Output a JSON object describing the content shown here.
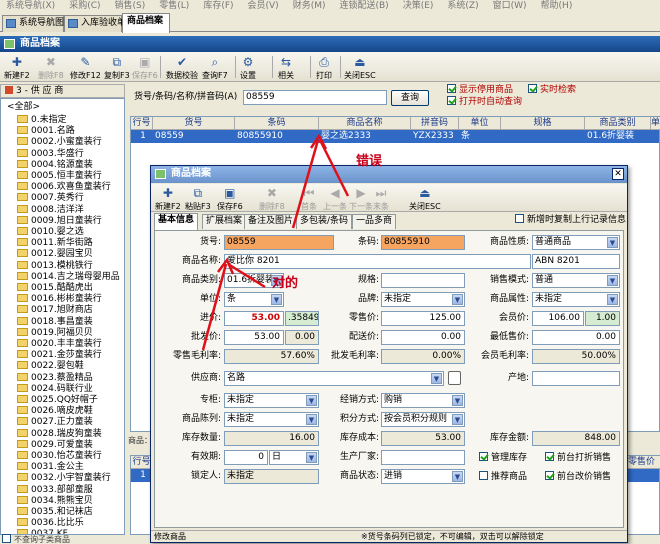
{
  "menu": [
    "系统导航(X)",
    "采购(C)",
    "销售(S)",
    "零售(L)",
    "库存(F)",
    "会员(V)",
    "财务(M)",
    "连锁配送(B)",
    "决策(E)",
    "系统(Z)",
    "窗口(W)",
    "帮助(H)"
  ],
  "tabs": [
    "系统导航图",
    "入库验收单",
    "商品档案"
  ],
  "main_window": {
    "title": "商品档案"
  },
  "main_toolbar": [
    {
      "label": "新建F2",
      "icon": "✚",
      "enabled": true
    },
    {
      "label": "删除F8",
      "icon": "✖",
      "enabled": false
    },
    {
      "label": "修改F12",
      "icon": "✎",
      "enabled": true
    },
    {
      "label": "复制F3",
      "icon": "⧉",
      "enabled": true
    },
    {
      "label": "保存F6",
      "icon": "▣",
      "enabled": false
    },
    {
      "label": "数据校验",
      "icon": "✔",
      "enabled": true
    },
    {
      "label": "查询F7",
      "icon": "⌕",
      "enabled": true
    },
    {
      "label": "设置",
      "icon": "⚙",
      "enabled": true
    },
    {
      "label": "相关",
      "icon": "⇆",
      "enabled": true
    },
    {
      "label": "打印",
      "icon": "⎙",
      "enabled": true
    },
    {
      "label": "关闭ESC",
      "icon": "⏏",
      "enabled": true
    }
  ],
  "tree": {
    "header": "3 - 供 应 商",
    "root": "<全部>",
    "items": [
      "0.未指定",
      "0001.名路",
      "0002.小蜜童装行",
      "0003.华盛行",
      "0004.铭源童装",
      "0005.恒丰童装行",
      "0006.欢喜鱼童装行",
      "0007.英秀行",
      "0008.洁洋洋",
      "0009.旭日童装行",
      "0010.婴之选",
      "0011.新华街路",
      "0012.婴园宝贝",
      "0013.模桃铁行",
      "0014.吉之瑞母婴用品",
      "0015.酷酷虎出",
      "0016.彬彬童装行",
      "0017.旭财商店",
      "0018.事昌童装",
      "0019.阿福贝贝",
      "0020.丰丰童装行",
      "0021.金莎童装行",
      "0022.婴包鞋",
      "0023.蔡盈精品",
      "0024.码联行业",
      "0025.QQ好帽子",
      "0026.嘀皮虎鞋",
      "0027.正力童装",
      "0028.瑞皮狗童装",
      "0029.可爱童装",
      "0030.怡芯童装行",
      "0031.金公主",
      "0032.小宇智童装行",
      "0033.部部童服",
      "0034.熊熊宝贝",
      "0035.和记袜店",
      "0036.比比乐",
      "0037.KF"
    ],
    "footer_label": "不查询子类商品"
  },
  "search": {
    "label": "货号/条码/名称/拼音码(A)",
    "value": "08559",
    "button": "查询"
  },
  "options": [
    {
      "label": "显示停用商品",
      "checked": true
    },
    {
      "label": "打开时自动查询",
      "checked": true
    },
    {
      "label": "实时检索",
      "checked": true
    }
  ],
  "grid": {
    "headers": [
      "行号",
      "货号",
      "条码",
      "商品名称",
      "拼音码",
      "单位",
      "规格",
      "商品类别",
      "单"
    ],
    "row": [
      "1",
      "08559",
      "80855910",
      "婴之选2333",
      "YZX2333",
      "条",
      "",
      "01.6折婴装",
      ""
    ]
  },
  "lower_grid": {
    "headers": [
      "行号",
      "商",
      "零售价"
    ],
    "row": [
      "1",
      "0"
    ]
  },
  "status": "商品：1 条",
  "annotations": {
    "wrong": "错误",
    "right": "对的"
  },
  "dialog": {
    "title": "商品档案",
    "toolbar": [
      {
        "label": "新建F2",
        "icon": "✚",
        "enabled": true
      },
      {
        "label": "粘贴F3",
        "icon": "⧉",
        "enabled": true
      },
      {
        "label": "保存F6",
        "icon": "▣",
        "enabled": true
      },
      {
        "label": "删除F8",
        "icon": "✖",
        "enabled": false
      },
      {
        "label": "首条",
        "icon": "⏮",
        "enabled": false
      },
      {
        "label": "上一条",
        "icon": "◀",
        "enabled": false
      },
      {
        "label": "下一条",
        "icon": "▶",
        "enabled": false
      },
      {
        "label": "末条",
        "icon": "⏭",
        "enabled": false
      },
      {
        "label": "关闭ESC",
        "icon": "⏏",
        "enabled": true
      }
    ],
    "tabs": [
      "基本信息",
      "扩展档案",
      "备注及图片",
      "多包装/条码",
      "一品多商"
    ],
    "copy_new_label": "新增时复制上行记录信息",
    "fields": {
      "goods_no": {
        "label": "货号:",
        "value": "08559"
      },
      "barcode": {
        "label": "条码:",
        "value": "80855910"
      },
      "goods_nature": {
        "label": "商品性质:",
        "value": "普通商品"
      },
      "goods_name": {
        "label": "商品名称:",
        "value": "爱比你 8201"
      },
      "goods_name_py": {
        "value": "ABN 8201"
      },
      "category": {
        "label": "商品类别:",
        "value": "01.6折婴装"
      },
      "spec": {
        "label": "规格:",
        "value": ""
      },
      "sale_mode": {
        "label": "销售模式:",
        "value": "普通"
      },
      "unit": {
        "label": "单位:",
        "value": "条"
      },
      "brand": {
        "label": "品牌:",
        "value": "未指定"
      },
      "attr": {
        "label": "商品属性:",
        "value": "未指定"
      },
      "purchase_price": {
        "label": "进价:",
        "value": "53.00",
        "ratio": ".358491"
      },
      "retail_price": {
        "label": "零售价:",
        "value": "125.00"
      },
      "member_price": {
        "label": "会员价:",
        "value": "106.00",
        "ratio": "1.00"
      },
      "wholesale_price": {
        "label": "批发价:",
        "value": "53.00",
        "ratio": "0.00"
      },
      "dist_price": {
        "label": "配送价:",
        "value": "0.00"
      },
      "min_price": {
        "label": "最低售价:",
        "value": "0.00"
      },
      "retail_margin": {
        "label": "零售毛利率:",
        "value": "57.60%"
      },
      "wholesale_margin": {
        "label": "批发毛利率:",
        "value": "0.00%"
      },
      "member_margin": {
        "label": "会员毛利率:",
        "value": "50.00%"
      },
      "supplier": {
        "label": "供应商:",
        "value": "名路"
      },
      "origin": {
        "label": "产地:",
        "value": ""
      },
      "counter": {
        "label": "专柜:",
        "value": "未指定"
      },
      "biz_mode": {
        "label": "经销方式:",
        "value": "购销"
      },
      "display": {
        "label": "商品陈列:",
        "value": "未指定"
      },
      "points": {
        "label": "积分方式:",
        "value": "按会员积分规则"
      },
      "stock_qty": {
        "label": "库存数量:",
        "value": "16.00"
      },
      "stock_cost": {
        "label": "库存成本:",
        "value": "53.00"
      },
      "stock_amount": {
        "label": "库存金额:",
        "value": "848.00"
      },
      "valid_period": {
        "label": "有效期:",
        "value": "0",
        "unit": "日"
      },
      "manufacturer": {
        "label": "生产厂家:",
        "value": ""
      },
      "locker": {
        "label": "锁定人:",
        "value": "未指定"
      },
      "goods_state": {
        "label": "商品状态:",
        "value": "进销"
      }
    },
    "checks": [
      {
        "label": "管理库存",
        "checked": true
      },
      {
        "label": "前台打折销售",
        "checked": true
      },
      {
        "label": "推荐商品",
        "checked": false
      },
      {
        "label": "前台改价销售",
        "checked": true
      }
    ],
    "status_left": "修改商品",
    "status_right": "※货号条码列已锁定，不可编辑，双击可以解除锁定"
  }
}
